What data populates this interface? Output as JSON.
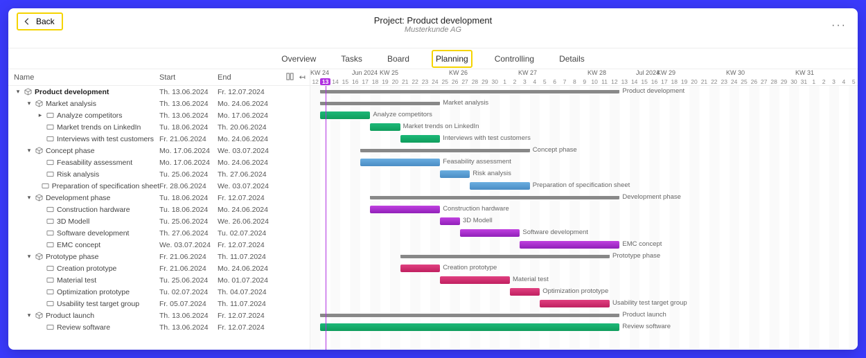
{
  "header": {
    "back_label": "Back",
    "project_prefix": "Project:",
    "project_name": "Product development",
    "customer": "Musterkunde AG"
  },
  "tabs": {
    "overview": "Overview",
    "tasks": "Tasks",
    "board": "Board",
    "planning": "Planning",
    "controlling": "Controlling",
    "details": "Details",
    "active": "planning"
  },
  "columns": {
    "name": "Name",
    "start": "Start",
    "end": "End"
  },
  "timeline": {
    "start_day_index": 0,
    "day_width": 14.4,
    "today_index": 1,
    "weeks": [
      {
        "label": "KW 24",
        "pos": 0
      },
      {
        "label": "Jun 2024",
        "pos": 60
      },
      {
        "label": "KW 25",
        "pos": 100
      },
      {
        "label": "KW 26",
        "pos": 200
      },
      {
        "label": "KW 27",
        "pos": 300
      },
      {
        "label": "KW 28",
        "pos": 400
      },
      {
        "label": "Jul 2024",
        "pos": 470
      },
      {
        "label": "KW 29",
        "pos": 500
      },
      {
        "label": "KW 30",
        "pos": 600
      },
      {
        "label": "KW 31",
        "pos": 700
      }
    ],
    "days": [
      "12",
      "13",
      "14",
      "15",
      "16",
      "17",
      "18",
      "19",
      "20",
      "21",
      "22",
      "23",
      "24",
      "25",
      "26",
      "27",
      "28",
      "29",
      "30",
      "1",
      "2",
      "3",
      "4",
      "5",
      "6",
      "7",
      "8",
      "9",
      "10",
      "11",
      "12",
      "13",
      "14",
      "15",
      "16",
      "17",
      "18",
      "19",
      "20",
      "21",
      "22",
      "23",
      "24",
      "25",
      "26",
      "27",
      "28",
      "29",
      "30",
      "31",
      "1",
      "2",
      "3",
      "4",
      "5"
    ]
  },
  "rows": [
    {
      "id": "r0",
      "level": 0,
      "caret": true,
      "icon": "cube",
      "bold": true,
      "name": "Product development",
      "start": "Th. 13.06.2024",
      "end": "Fr. 12.07.2024",
      "bar_start": 1,
      "bar_end": 30,
      "bar_type": "summary",
      "color": ""
    },
    {
      "id": "r1",
      "level": 1,
      "caret": true,
      "icon": "cube",
      "bold": false,
      "name": "Market analysis",
      "start": "Th. 13.06.2024",
      "end": "Mo. 24.06.2024",
      "bar_start": 1,
      "bar_end": 12,
      "bar_type": "summary",
      "color": ""
    },
    {
      "id": "r2",
      "level": 2,
      "caret": true,
      "icon": "task",
      "bold": false,
      "name": "Analyze competitors",
      "start": "Th. 13.06.2024",
      "end": "Mo. 17.06.2024",
      "bar_start": 1,
      "bar_end": 5,
      "bar_type": "task",
      "color": "c1"
    },
    {
      "id": "r3",
      "level": 2,
      "caret": false,
      "icon": "task",
      "bold": false,
      "name": "Market trends on LinkedIn",
      "start": "Tu. 18.06.2024",
      "end": "Th. 20.06.2024",
      "bar_start": 6,
      "bar_end": 8,
      "bar_type": "task",
      "color": "c1"
    },
    {
      "id": "r4",
      "level": 2,
      "caret": false,
      "icon": "task",
      "bold": false,
      "name": "Interviews with test customers",
      "start": "Fr. 21.06.2024",
      "end": "Mo. 24.06.2024",
      "bar_start": 9,
      "bar_end": 12,
      "bar_type": "task",
      "color": "c1"
    },
    {
      "id": "r5",
      "level": 1,
      "caret": true,
      "icon": "cube",
      "bold": false,
      "name": "Concept phase",
      "start": "Mo. 17.06.2024",
      "end": "We. 03.07.2024",
      "bar_start": 5,
      "bar_end": 21,
      "bar_type": "summary",
      "color": ""
    },
    {
      "id": "r6",
      "level": 2,
      "caret": false,
      "icon": "task",
      "bold": false,
      "name": "Feasability assessment",
      "start": "Mo. 17.06.2024",
      "end": "Mo. 24.06.2024",
      "bar_start": 5,
      "bar_end": 12,
      "bar_type": "task",
      "color": "c2"
    },
    {
      "id": "r7",
      "level": 2,
      "caret": false,
      "icon": "task",
      "bold": false,
      "name": "Risk analysis",
      "start": "Tu. 25.06.2024",
      "end": "Th. 27.06.2024",
      "bar_start": 13,
      "bar_end": 15,
      "bar_type": "task",
      "color": "c2"
    },
    {
      "id": "r8",
      "level": 2,
      "caret": false,
      "icon": "task",
      "bold": false,
      "name": "Preparation of specification sheet",
      "start": "Fr. 28.06.2024",
      "end": "We. 03.07.2024",
      "bar_start": 16,
      "bar_end": 21,
      "bar_type": "task",
      "color": "c2"
    },
    {
      "id": "r9",
      "level": 1,
      "caret": true,
      "icon": "cube",
      "bold": false,
      "name": "Development phase",
      "start": "Tu. 18.06.2024",
      "end": "Fr. 12.07.2024",
      "bar_start": 6,
      "bar_end": 30,
      "bar_type": "summary",
      "color": ""
    },
    {
      "id": "r10",
      "level": 2,
      "caret": false,
      "icon": "task",
      "bold": false,
      "name": "Construction hardware",
      "start": "Tu. 18.06.2024",
      "end": "Mo. 24.06.2024",
      "bar_start": 6,
      "bar_end": 12,
      "bar_type": "task",
      "color": "c3"
    },
    {
      "id": "r11",
      "level": 2,
      "caret": false,
      "icon": "task",
      "bold": false,
      "name": "3D Modell",
      "start": "Tu. 25.06.2024",
      "end": "We. 26.06.2024",
      "bar_start": 13,
      "bar_end": 14,
      "bar_type": "task",
      "color": "c3"
    },
    {
      "id": "r12",
      "level": 2,
      "caret": false,
      "icon": "task",
      "bold": false,
      "name": "Software development",
      "start": "Th. 27.06.2024",
      "end": "Tu. 02.07.2024",
      "bar_start": 15,
      "bar_end": 20,
      "bar_type": "task",
      "color": "c3"
    },
    {
      "id": "r13",
      "level": 2,
      "caret": false,
      "icon": "task",
      "bold": false,
      "name": "EMC concept",
      "start": "We. 03.07.2024",
      "end": "Fr. 12.07.2024",
      "bar_start": 21,
      "bar_end": 30,
      "bar_type": "task",
      "color": "c3"
    },
    {
      "id": "r14",
      "level": 1,
      "caret": true,
      "icon": "cube",
      "bold": false,
      "name": "Prototype phase",
      "start": "Fr. 21.06.2024",
      "end": "Th. 11.07.2024",
      "bar_start": 9,
      "bar_end": 29,
      "bar_type": "summary",
      "color": ""
    },
    {
      "id": "r15",
      "level": 2,
      "caret": false,
      "icon": "task",
      "bold": false,
      "name": "Creation prototype",
      "start": "Fr. 21.06.2024",
      "end": "Mo. 24.06.2024",
      "bar_start": 9,
      "bar_end": 12,
      "bar_type": "task",
      "color": "c4"
    },
    {
      "id": "r16",
      "level": 2,
      "caret": false,
      "icon": "task",
      "bold": false,
      "name": "Material test",
      "start": "Tu. 25.06.2024",
      "end": "Mo. 01.07.2024",
      "bar_start": 13,
      "bar_end": 19,
      "bar_type": "task",
      "color": "c4"
    },
    {
      "id": "r17",
      "level": 2,
      "caret": false,
      "icon": "task",
      "bold": false,
      "name": "Optimization prototype",
      "start": "Tu. 02.07.2024",
      "end": "Th. 04.07.2024",
      "bar_start": 20,
      "bar_end": 22,
      "bar_type": "task",
      "color": "c4"
    },
    {
      "id": "r18",
      "level": 2,
      "caret": false,
      "icon": "task",
      "bold": false,
      "name": "Usability test target group",
      "start": "Fr. 05.07.2024",
      "end": "Th. 11.07.2024",
      "bar_start": 23,
      "bar_end": 29,
      "bar_type": "task",
      "color": "c4"
    },
    {
      "id": "r19",
      "level": 1,
      "caret": true,
      "icon": "cube",
      "bold": false,
      "name": "Product launch",
      "start": "Th. 13.06.2024",
      "end": "Fr. 12.07.2024",
      "bar_start": 1,
      "bar_end": 30,
      "bar_type": "summary",
      "color": ""
    },
    {
      "id": "r20",
      "level": 2,
      "caret": false,
      "icon": "task",
      "bold": false,
      "name": "Review software",
      "start": "Th. 13.06.2024",
      "end": "Fr. 12.07.2024",
      "bar_start": 1,
      "bar_end": 30,
      "bar_type": "task",
      "color": "c5"
    }
  ],
  "chart_data": {
    "type": "gantt",
    "title": "Product development",
    "x_unit": "calendar days (12 Jun 2024 – 5 Aug 2024)",
    "today": "13.06.2024",
    "tasks": [
      {
        "name": "Product development",
        "start": "2024-06-13",
        "end": "2024-07-12",
        "type": "summary"
      },
      {
        "name": "Market analysis",
        "start": "2024-06-13",
        "end": "2024-06-24",
        "type": "summary",
        "parent": "Product development"
      },
      {
        "name": "Analyze competitors",
        "start": "2024-06-13",
        "end": "2024-06-17",
        "color": "green",
        "parent": "Market analysis"
      },
      {
        "name": "Market trends on LinkedIn",
        "start": "2024-06-18",
        "end": "2024-06-20",
        "color": "green",
        "parent": "Market analysis"
      },
      {
        "name": "Interviews with test customers",
        "start": "2024-06-21",
        "end": "2024-06-24",
        "color": "green",
        "parent": "Market analysis"
      },
      {
        "name": "Concept phase",
        "start": "2024-06-17",
        "end": "2024-07-03",
        "type": "summary",
        "parent": "Product development"
      },
      {
        "name": "Feasability assessment",
        "start": "2024-06-17",
        "end": "2024-06-24",
        "color": "blue",
        "parent": "Concept phase"
      },
      {
        "name": "Risk analysis",
        "start": "2024-06-25",
        "end": "2024-06-27",
        "color": "blue",
        "parent": "Concept phase"
      },
      {
        "name": "Preparation of specification sheet",
        "start": "2024-06-28",
        "end": "2024-07-03",
        "color": "blue",
        "parent": "Concept phase"
      },
      {
        "name": "Development phase",
        "start": "2024-06-18",
        "end": "2024-07-12",
        "type": "summary",
        "parent": "Product development"
      },
      {
        "name": "Construction hardware",
        "start": "2024-06-18",
        "end": "2024-06-24",
        "color": "purple",
        "parent": "Development phase"
      },
      {
        "name": "3D Modell",
        "start": "2024-06-25",
        "end": "2024-06-26",
        "color": "purple",
        "parent": "Development phase"
      },
      {
        "name": "Software development",
        "start": "2024-06-27",
        "end": "2024-07-02",
        "color": "purple",
        "parent": "Development phase"
      },
      {
        "name": "EMC concept",
        "start": "2024-07-03",
        "end": "2024-07-12",
        "color": "purple",
        "parent": "Development phase"
      },
      {
        "name": "Prototype phase",
        "start": "2024-06-21",
        "end": "2024-07-11",
        "type": "summary",
        "parent": "Product development"
      },
      {
        "name": "Creation prototype",
        "start": "2024-06-21",
        "end": "2024-06-24",
        "color": "pink",
        "parent": "Prototype phase"
      },
      {
        "name": "Material test",
        "start": "2024-06-25",
        "end": "2024-07-01",
        "color": "pink",
        "parent": "Prototype phase"
      },
      {
        "name": "Optimization prototype",
        "start": "2024-07-02",
        "end": "2024-07-04",
        "color": "pink",
        "parent": "Prototype phase"
      },
      {
        "name": "Usability test target group",
        "start": "2024-07-05",
        "end": "2024-07-11",
        "color": "pink",
        "parent": "Prototype phase"
      },
      {
        "name": "Product launch",
        "start": "2024-06-13",
        "end": "2024-07-12",
        "type": "summary",
        "parent": "Product development"
      },
      {
        "name": "Review software",
        "start": "2024-06-13",
        "end": "2024-07-12",
        "color": "green",
        "parent": "Product launch"
      }
    ]
  }
}
